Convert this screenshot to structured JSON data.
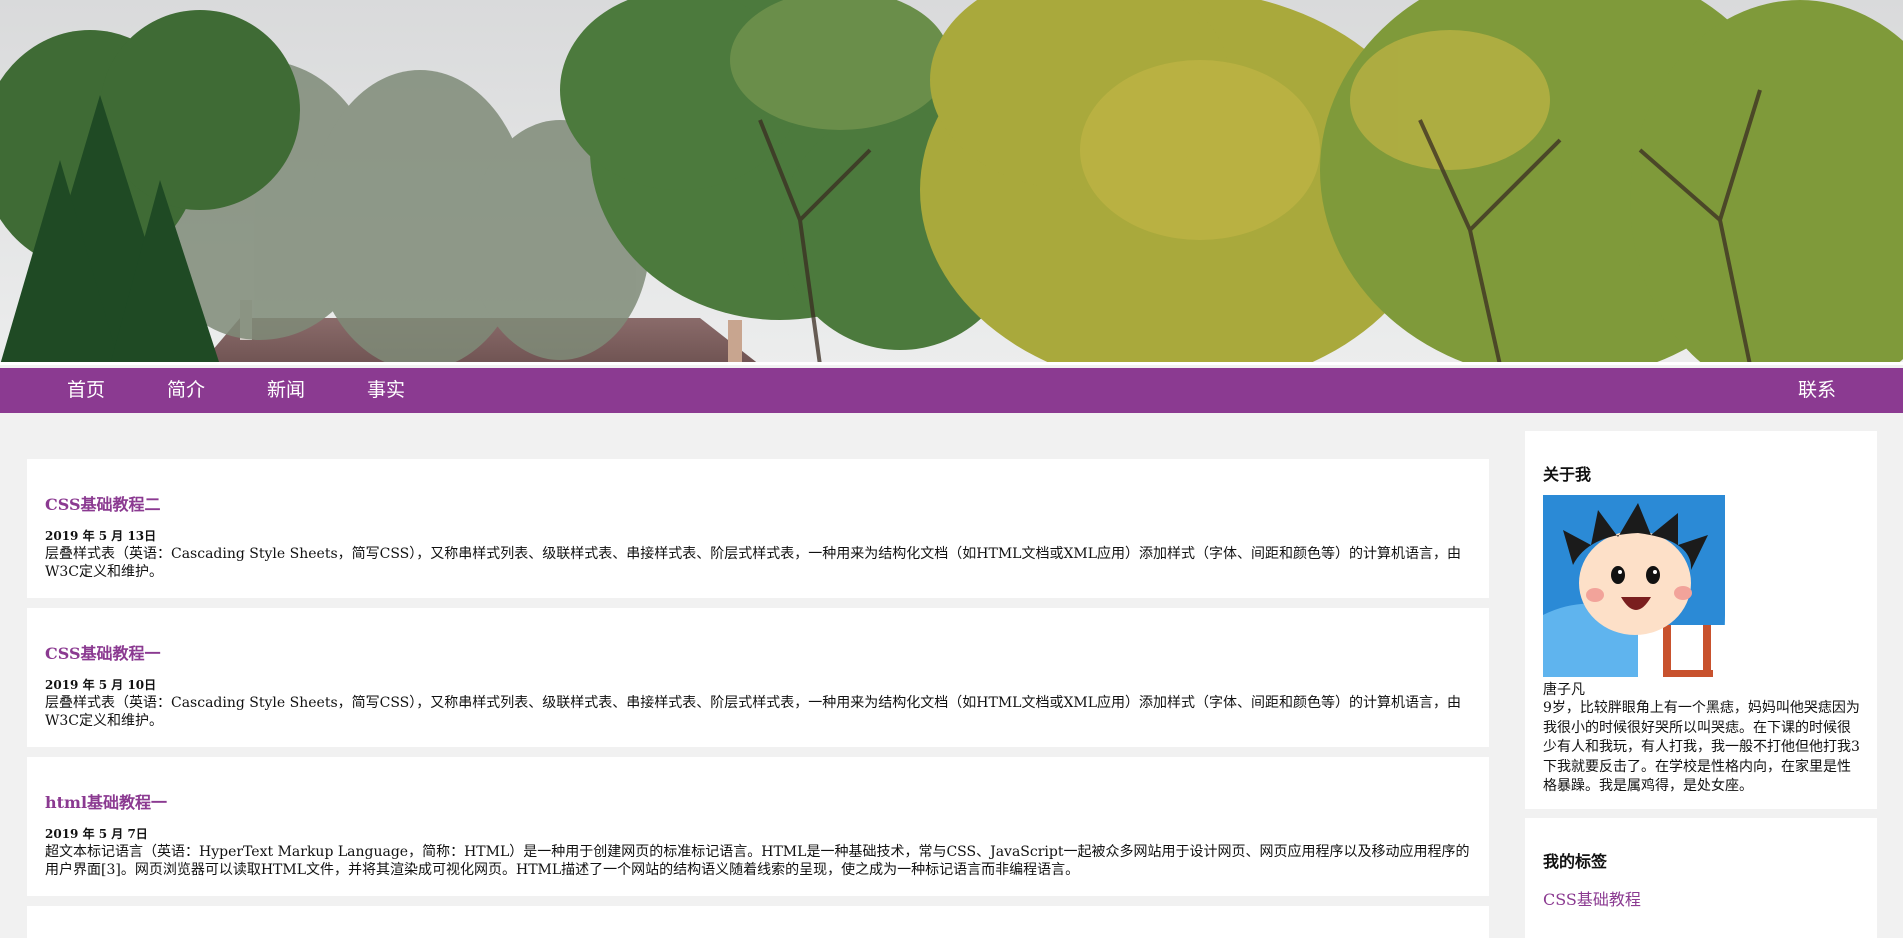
{
  "nav": {
    "items": [
      "首页",
      "简介",
      "新闻",
      "事实"
    ],
    "contact": "联系"
  },
  "posts": [
    {
      "title": "CSS基础教程二",
      "date": "2019 年 5 月 13日",
      "text": "层叠样式表（英语：Cascading Style Sheets，简写CSS），又称串样式列表、级联样式表、串接样式表、阶层式样式表，一种用来为结构化文档（如HTML文档或XML应用）添加样式（字体、间距和颜色等）的计算机语言，由W3C定义和维护。"
    },
    {
      "title": "CSS基础教程一",
      "date": "2019 年 5 月 10日",
      "text": "层叠样式表（英语：Cascading Style Sheets，简写CSS），又称串样式列表、级联样式表、串接样式表、阶层式样式表，一种用来为结构化文档（如HTML文档或XML应用）添加样式（字体、间距和颜色等）的计算机语言，由W3C定义和维护。"
    },
    {
      "title": "html基础教程一",
      "date": "2019 年 5 月 7日",
      "text": "超文本标记语言（英语：HyperText Markup Language，简称：HTML）是一种用于创建网页的标准标记语言。HTML是一种基础技术，常与CSS、JavaScript一起被众多网站用于设计网页、网页应用程序以及移动应用程序的用户界面[3]。网页浏览器可以读取HTML文件，并将其渲染成可视化网页。HTML描述了一个网站的结构语义随着线索的呈现，使之成为一种标记语言而非编程语言。"
    }
  ],
  "sidebar": {
    "about_heading": "关于我",
    "name": "唐子凡",
    "bio": "9岁，比较胖眼角上有一个黑痣，妈妈叫他哭痣因为我很小的时候很好哭所以叫哭痣。在下课的时候很少有人和我玩，有人打我，我一般不打他但他打我3下我就要反击了。在学校是性格内向，在家里是性格暴躁。我是属鸡得，是处女座。",
    "tags_heading": "我的标签",
    "tags": [
      "CSS基础教程"
    ]
  },
  "colors": {
    "accent": "#8b3a91",
    "page_bg": "#f1f1f1",
    "card_bg": "#ffffff"
  }
}
